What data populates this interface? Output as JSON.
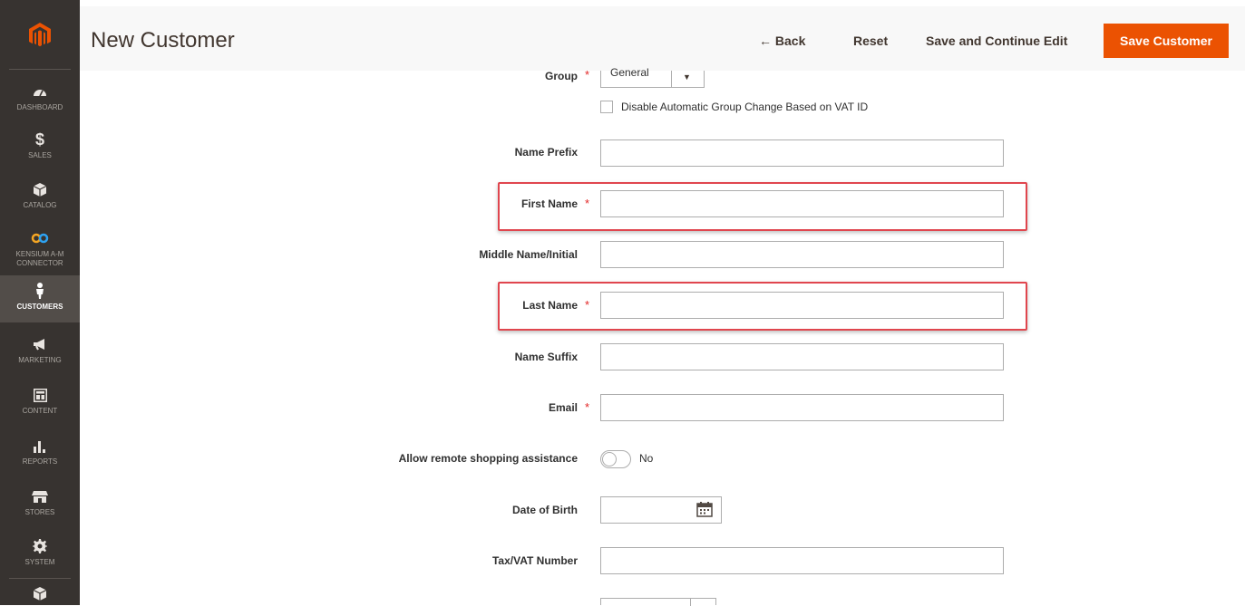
{
  "sidebar": {
    "items": [
      {
        "label": "DASHBOARD",
        "icon": "speedometer-icon"
      },
      {
        "label": "SALES",
        "icon": "dollar-icon"
      },
      {
        "label": "CATALOG",
        "icon": "box-icon"
      },
      {
        "label": "KENSIUM A-M CONNECTOR",
        "icon": "infinity-icon"
      },
      {
        "label": "CUSTOMERS",
        "icon": "person-icon"
      },
      {
        "label": "MARKETING",
        "icon": "megaphone-icon"
      },
      {
        "label": "CONTENT",
        "icon": "layout-icon"
      },
      {
        "label": "REPORTS",
        "icon": "bar-chart-icon"
      },
      {
        "label": "STORES",
        "icon": "storefront-icon"
      },
      {
        "label": "SYSTEM",
        "icon": "gear-icon"
      }
    ]
  },
  "header": {
    "title": "New Customer",
    "back_label": "← Back",
    "reset_label": "Reset",
    "save_continue_label": "Save and Continue Edit",
    "save_label": "Save Customer"
  },
  "form": {
    "group": {
      "label": "Group",
      "value": "General",
      "required": true
    },
    "disable_auto_group": {
      "label": "Disable Automatic Group Change Based on VAT ID",
      "checked": false
    },
    "name_prefix": {
      "label": "Name Prefix",
      "value": ""
    },
    "first_name": {
      "label": "First Name",
      "value": "",
      "required": true
    },
    "middle_name": {
      "label": "Middle Name/Initial",
      "value": ""
    },
    "last_name": {
      "label": "Last Name",
      "value": "",
      "required": true
    },
    "name_suffix": {
      "label": "Name Suffix",
      "value": ""
    },
    "email": {
      "label": "Email",
      "value": "",
      "required": true
    },
    "remote_assist": {
      "label": "Allow remote shopping assistance",
      "value_label": "No",
      "on": false
    },
    "dob": {
      "label": "Date of Birth",
      "value": ""
    },
    "tax_vat": {
      "label": "Tax/VAT Number",
      "value": ""
    }
  },
  "colors": {
    "accent": "#eb5202",
    "sidebar": "#373330",
    "required": "#e22626",
    "highlight": "#e0464e"
  }
}
